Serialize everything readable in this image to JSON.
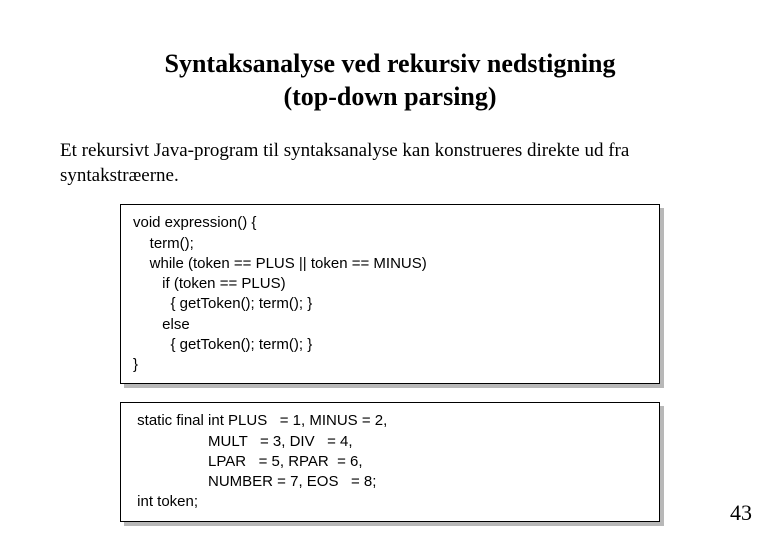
{
  "title_line1": "Syntaksanalyse ved rekursiv nedstigning",
  "title_line2": "(top-down parsing)",
  "intro": "Et rekursivt Java-program til syntaksanalyse kan konstrueres direkte ud fra syntakstræerne.",
  "code1": "void expression() {\n    term();\n    while (token == PLUS || token == MINUS)\n       if (token == PLUS)\n         { getToken(); term(); }\n       else\n         { getToken(); term(); }\n}",
  "code2": " static final int PLUS   = 1, MINUS = 2,\n                  MULT   = 3, DIV   = 4,\n                  LPAR   = 5, RPAR  = 6,\n                  NUMBER = 7, EOS   = 8;\n int token;",
  "page_number": "43"
}
